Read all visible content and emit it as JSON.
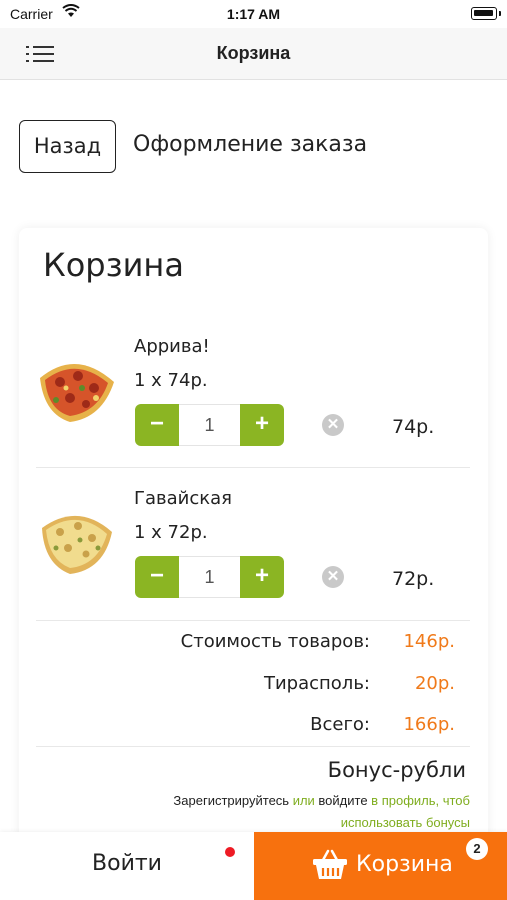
{
  "status_bar": {
    "carrier": "Carrier",
    "time": "1:17 AM"
  },
  "nav": {
    "title": "Корзина",
    "menu_icon": "hamburger-menu-icon"
  },
  "actions": {
    "back_label": "Назад",
    "checkout_label": "Оформление заказа"
  },
  "cart": {
    "title": "Корзина",
    "items": [
      {
        "name": "Аррива!",
        "unit_price": "1 x 74р.",
        "qty": "1",
        "price": "74р.",
        "minus": "−",
        "plus": "+",
        "remove": "✕"
      },
      {
        "name": "Гавайская",
        "unit_price": "1 x 72р.",
        "qty": "1",
        "price": "72р.",
        "minus": "−",
        "plus": "+",
        "remove": "✕"
      }
    ],
    "summary": {
      "goods_label": "Стоимость товаров:",
      "goods_value": "146р.",
      "city_label": "Тирасполь:",
      "city_value": "20р.",
      "total_label": "Всего:",
      "total_value": "166р."
    },
    "bonus": {
      "title": "Бонус-рубли",
      "part1": "Зарегистрируйтесь ",
      "part2": "или",
      "part3": " войдите ",
      "part4": "в профиль, чтоб",
      "part5": "использовать бонусы"
    }
  },
  "bottom": {
    "login_label": "Войти",
    "cart_label": "Корзина",
    "cart_count": "2"
  },
  "colors": {
    "accent_green": "#8bb523",
    "accent_orange": "#f7710e",
    "price_orange": "#f07a1a",
    "notification_red": "#ee1b24"
  }
}
